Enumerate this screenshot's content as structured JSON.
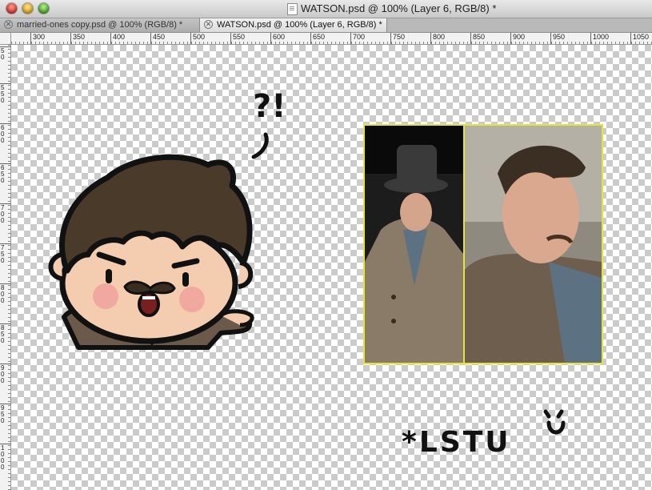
{
  "window": {
    "title": "WATSON.psd @ 100% (Layer 6, RGB/8) *"
  },
  "tabs": [
    {
      "label": "married-ones copy.psd @ 100% (RGB/8) *",
      "active": false
    },
    {
      "label": "WATSON.psd @ 100% (Layer 6, RGB/8) *",
      "active": true
    }
  ],
  "ruler": {
    "horizontal_labels": [
      "300",
      "350",
      "400",
      "450",
      "500",
      "550",
      "600",
      "650",
      "700",
      "750",
      "800",
      "850",
      "900",
      "950",
      "1000",
      "1050"
    ],
    "vertical_labels": [
      "50",
      "550",
      "600",
      "650",
      "700",
      "750",
      "800",
      "850",
      "900",
      "950",
      "1000"
    ]
  },
  "artwork": {
    "speech_marks": "?!",
    "caption": "*LSTU",
    "smiley": "ᵕ̈",
    "colors": {
      "hair": "#4a3a2a",
      "skin": "#f4cdb0",
      "cheek": "#f0a8a0",
      "coat": "#6b5a4a",
      "outline": "#111111",
      "frame": "#e6e33a"
    }
  },
  "icons": {
    "close": "close-window-icon",
    "minimize": "minimize-window-icon",
    "zoom": "zoom-window-icon",
    "document": "document-proxy-icon",
    "tab_close": "tab-close-icon"
  }
}
